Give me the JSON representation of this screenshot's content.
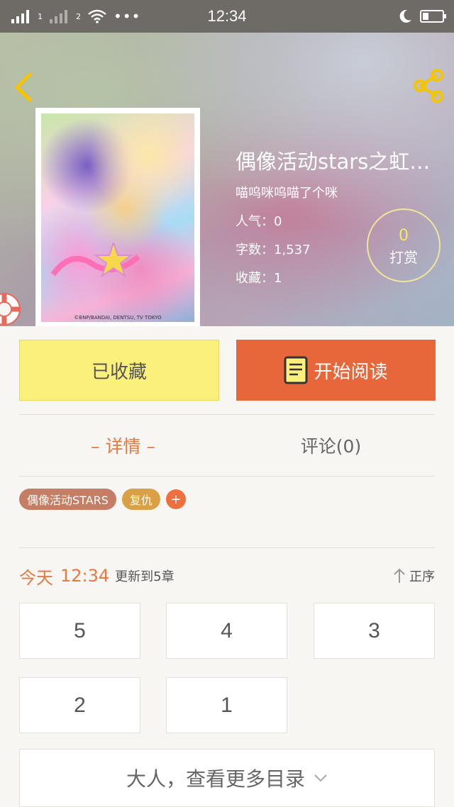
{
  "status_bar": {
    "sim1": "1",
    "sim2": "2",
    "dots": "•••",
    "time": "12:34"
  },
  "book": {
    "title": "偶像活动stars之虹…",
    "author": "喵呜咪呜喵了个咪",
    "stats": [
      {
        "key": "人气：",
        "value": "0"
      },
      {
        "key": "字数：",
        "value": "1,537"
      },
      {
        "key": "收藏：",
        "value": "1"
      }
    ],
    "cover_copyright": "©BNP/BANDAI, DENTSU, TV TOKYO"
  },
  "reward": {
    "count": "0",
    "label": "打赏"
  },
  "actions": {
    "favorited_label": "已收藏",
    "read_label": "开始阅读"
  },
  "tabs": [
    {
      "label": "– 详情 –"
    },
    {
      "label": "评论(0)"
    }
  ],
  "tags": [
    {
      "label": "偶像活动STARS"
    },
    {
      "label": "复仇"
    },
    {
      "label": "+"
    }
  ],
  "update": {
    "day": "今天",
    "time": "12:34",
    "note": "更新到5章",
    "sort_label": "正序"
  },
  "chapters": [
    "5",
    "4",
    "3",
    "2",
    "1"
  ],
  "more_label": "大人，查看更多目录",
  "colors": {
    "accent": "#e8673a",
    "favorite_bg": "#fcf07c",
    "tag_primary": "#c57d63",
    "tag_secondary": "#d9a046",
    "reward_count": "#f7e76a"
  },
  "icons": [
    "back-chevron-icon",
    "share-icon",
    "lifebuoy-icon",
    "book-icon",
    "sort-up-arrow-icon",
    "chevron-down-icon",
    "wifi-icon",
    "moon-icon",
    "battery-icon"
  ]
}
